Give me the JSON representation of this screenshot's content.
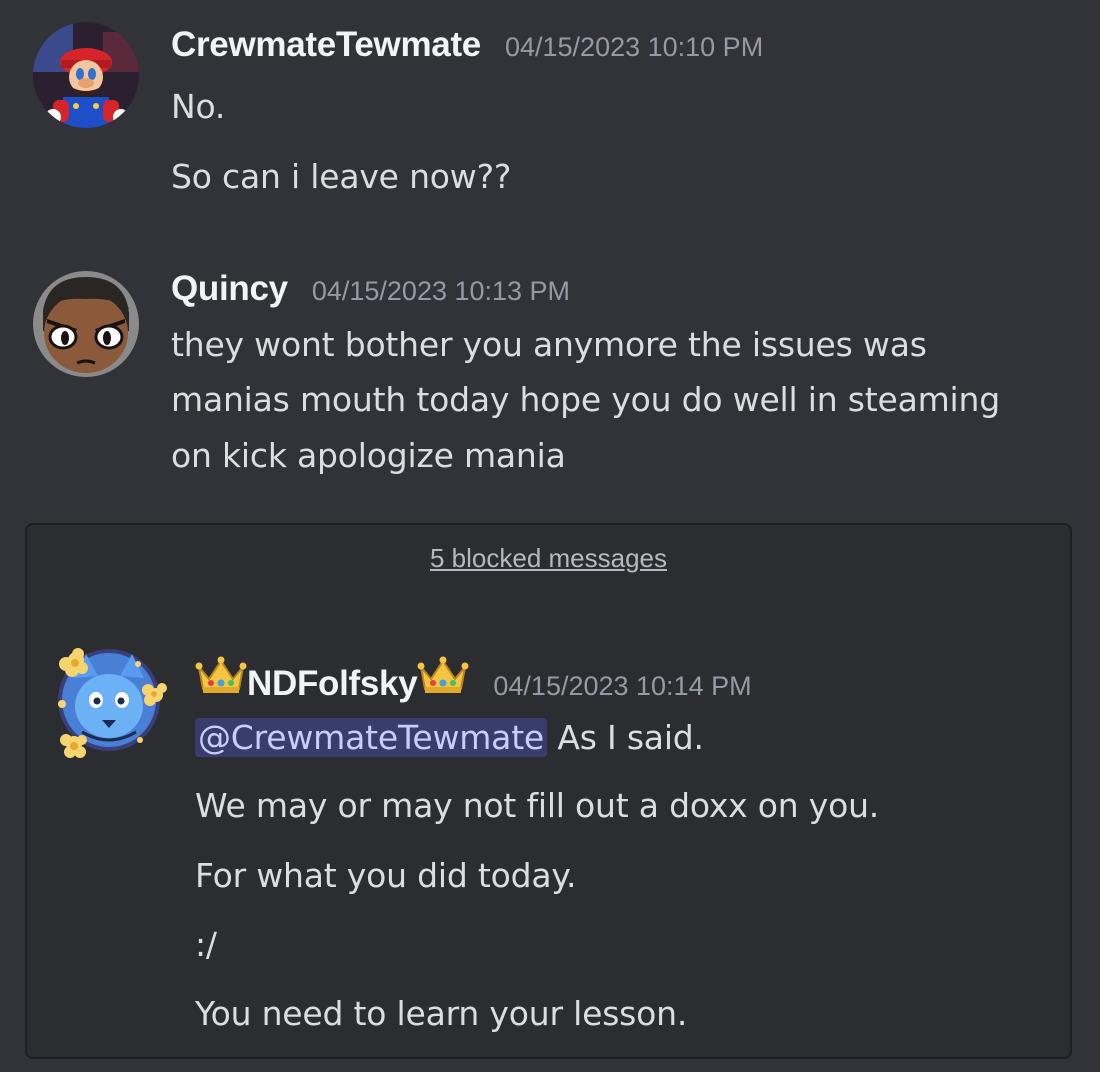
{
  "messages": [
    {
      "username": "CrewmateTewmate",
      "timestamp": "04/15/2023 10:10 PM",
      "lines": [
        "No.",
        "So can i leave now??"
      ]
    },
    {
      "username": "Quincy",
      "timestamp": "04/15/2023 10:13 PM",
      "lines": [
        "they wont bother you anymore the issues was",
        "manias mouth today hope you do well in steaming",
        "on kick apologize mania"
      ]
    }
  ],
  "blocked": {
    "link_label": "5 blocked messages",
    "message": {
      "username": "NDFolfsky",
      "username_icon": "crown-icon",
      "timestamp": "04/15/2023 10:14 PM",
      "mention": "@CrewmateTewmate",
      "first_line_rest": " As I said.",
      "lines": [
        "We may or may not fill out a doxx on you.",
        "For what you did today.",
        ":/",
        "You need to learn your lesson."
      ]
    }
  },
  "colors": {
    "background": "#313338",
    "blocked_background": "#2b2d31",
    "mention_background": "#3c4270",
    "mention_text": "#c9cdfb"
  }
}
